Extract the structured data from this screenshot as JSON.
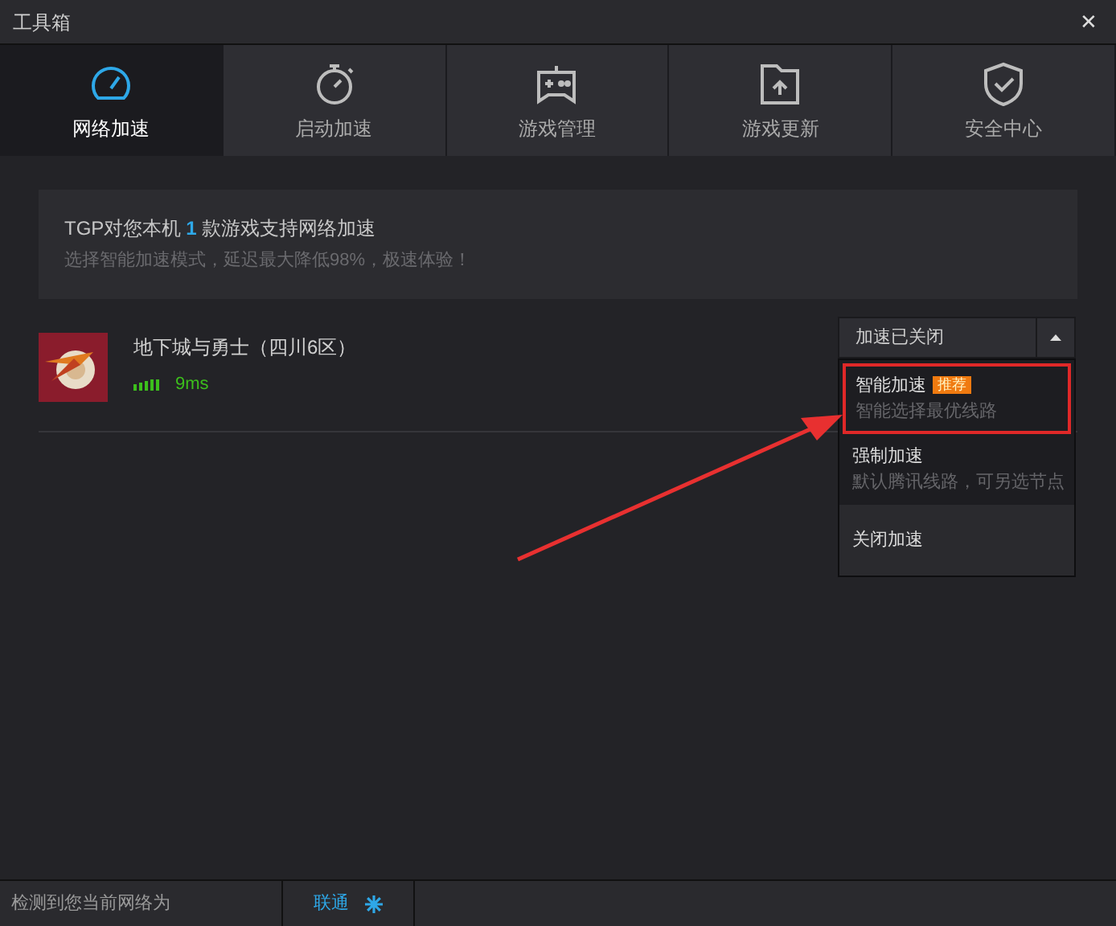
{
  "window": {
    "title": "工具箱",
    "close": "✕"
  },
  "tabs": [
    {
      "label": "网络加速",
      "selected": true
    },
    {
      "label": "启动加速",
      "selected": false
    },
    {
      "label": "游戏管理",
      "selected": false
    },
    {
      "label": "游戏更新",
      "selected": false
    },
    {
      "label": "安全中心",
      "selected": false
    }
  ],
  "info": {
    "prefix": "TGP对您本机",
    "count": "1",
    "suffix": "款游戏支持网络加速",
    "subtitle": "选择智能加速模式，延迟最大降低98%，极速体验！"
  },
  "games": [
    {
      "name": "地下城与勇士（四川6区）",
      "ping": "9ms",
      "dropdown": "加速已关闭",
      "expanded": true
    }
  ],
  "menu": [
    {
      "title": "智能加速",
      "badge": "推荐",
      "description": "智能选择最优线路",
      "highlighted": true
    },
    {
      "title": "强制加速",
      "description": "默认腾讯线路，可另选节点",
      "highlighted": false
    },
    {
      "title": "关闭加速",
      "highlighted": false
    }
  ],
  "status_bar": {
    "label": "检测到您当前网络为",
    "network": "联通"
  }
}
